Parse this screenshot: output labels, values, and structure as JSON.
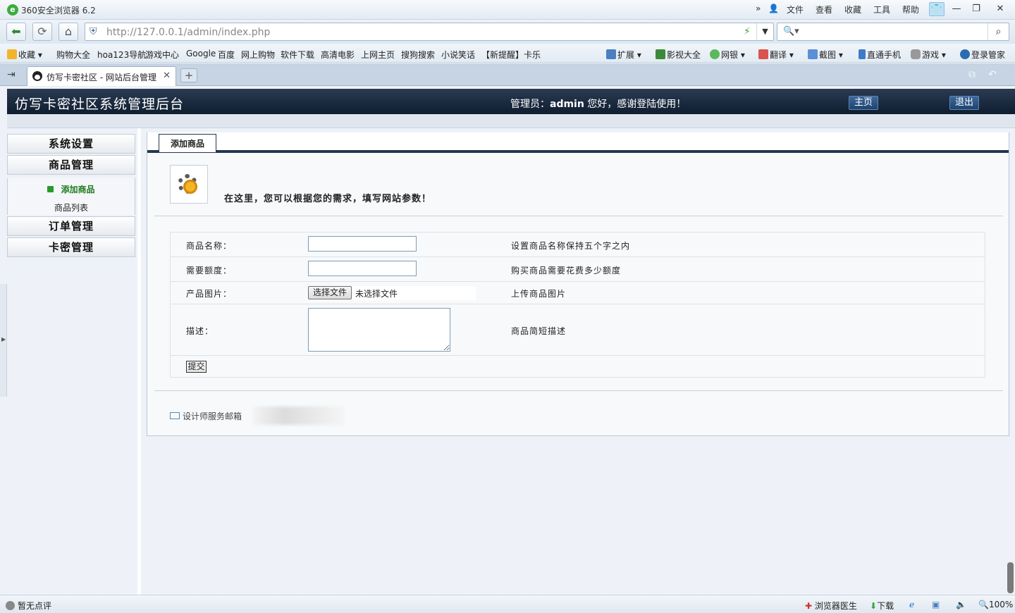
{
  "browser": {
    "app_title": "360安全浏览器 6.2",
    "menu": [
      "文件",
      "查看",
      "收藏",
      "工具",
      "帮助"
    ],
    "url": "http://127.0.0.1/admin/index.php",
    "search_placeholder": "",
    "favorites": [
      "收藏",
      "购物大全",
      "hoa123导航",
      "游戏中心",
      "Google",
      "百度",
      "网上购物",
      "软件下载",
      "高清电影",
      "上网主页",
      "搜狗搜索",
      "小说笑话",
      "【新提醒】卡乐"
    ],
    "right_tools": [
      "扩展",
      "影视大全",
      "网银",
      "翻译",
      "截图",
      "直通手机",
      "游戏",
      "登录管家"
    ],
    "tab_title": "仿写卡密社区 - 网站后台管理",
    "status": {
      "left": "暂无点评",
      "doctor": "浏览器医生",
      "download": "下载",
      "zoom": "100%"
    }
  },
  "header": {
    "title": "仿写卡密社区系统管理后台",
    "admin_prefix": "管理员：",
    "admin_name": "admin",
    "admin_suffix": " 您好，感谢登陆使用！",
    "home_btn": "主页",
    "logout_btn": "退出"
  },
  "sidebar": {
    "system": "系统设置",
    "goods": "商品管理",
    "sub_add": "添加商品",
    "sub_list": "商品列表",
    "orders": "订单管理",
    "cards": "卡密管理"
  },
  "main": {
    "tab": "添加商品",
    "intro": "在这里，您可以根据您的需求，填写网站参数！",
    "rows": [
      {
        "label": "商品名称：",
        "hint": "设置商品名称保持五个字之内",
        "value": ""
      },
      {
        "label": "需要额度：",
        "hint": "购买商品需要花费多少额度",
        "value": ""
      },
      {
        "label": "产品图片：",
        "hint": "上传商品图片",
        "file_btn": "选择文件",
        "file_text": "未选择文件"
      },
      {
        "label": "描述：",
        "hint": "商品简短描述",
        "value": ""
      }
    ],
    "submit": "提交",
    "footer_mail": "设计师服务邮箱"
  }
}
